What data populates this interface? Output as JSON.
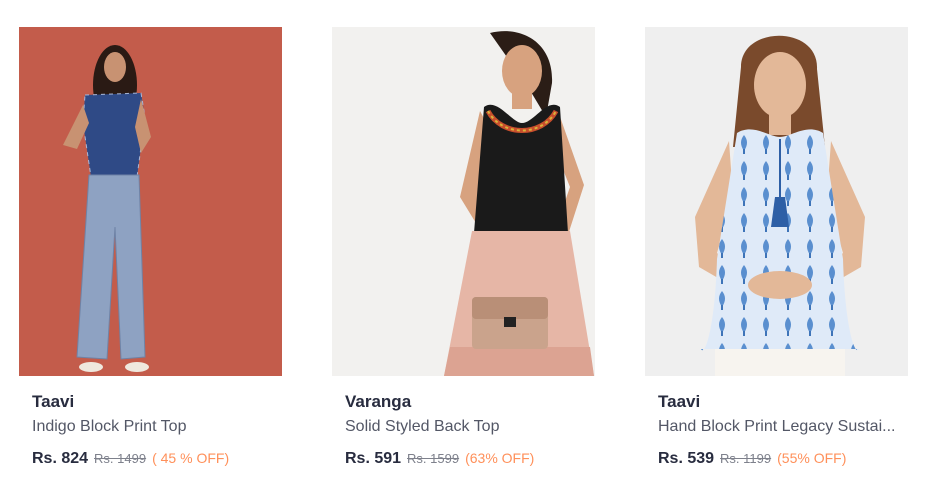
{
  "products": [
    {
      "image_alt": "Model wearing Indigo Block Print Top and jeans",
      "brand": "Taavi",
      "name": "Indigo Block Print Top",
      "price": "Rs. 824",
      "mrp": "Rs. 1499",
      "discount": "( 45 % OFF)",
      "bg_color": "#c7604f"
    },
    {
      "image_alt": "Model wearing black sleeveless top with embroidered neckline",
      "brand": "Varanga",
      "name": "Solid Styled Back Top",
      "price": "Rs. 591",
      "mrp": "Rs. 1599",
      "discount": "(63% OFF)",
      "bg_color": "#f2f1ef"
    },
    {
      "image_alt": "Model wearing blue block print sleeveless top",
      "brand": "Taavi",
      "name": "Hand Block Print Legacy Sustai...",
      "price": "Rs. 539",
      "mrp": "Rs. 1199",
      "discount": "(55% OFF)",
      "bg_color": "#efefef"
    }
  ],
  "colors": {
    "text": "#282c3f",
    "subtext": "#535766",
    "mrp": "#7e818c",
    "discount": "#ff905a"
  }
}
